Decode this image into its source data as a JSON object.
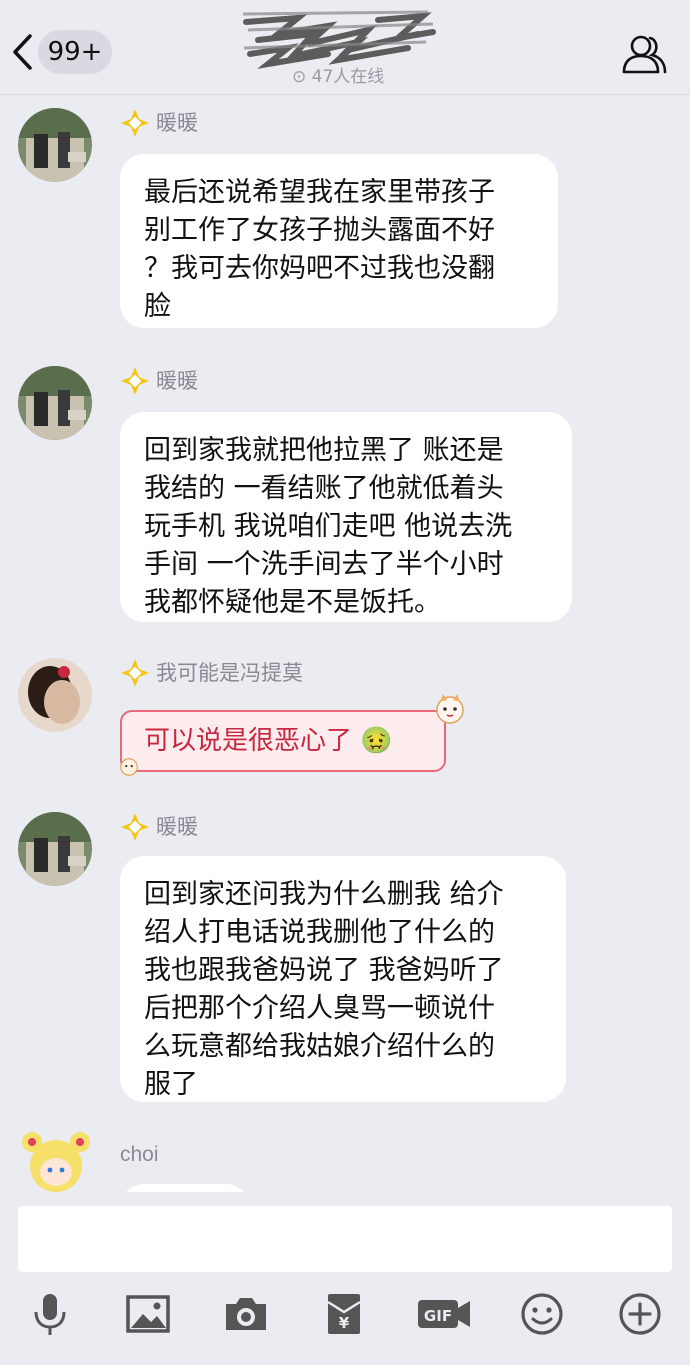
{
  "header": {
    "unread_count": "99+",
    "online_status": "47人在线"
  },
  "messages": [
    {
      "sender": "暖暖",
      "text": "最后还说希望我在家里带孩子\n别工作了女孩子抛头露面不好\n？我可去你妈吧不过我也没翻\n脸"
    },
    {
      "sender": "暖暖",
      "text": "回到家我就把他拉黑了 账还是\n我结的 一看结账了他就低着头\n玩手机 我说咱们走吧 他说去洗\n手间 一个洗手间去了半个小时\n我都怀疑他是不是饭托。"
    },
    {
      "sender": "我可能是冯提莫",
      "text": "可以说是很恶心了",
      "emoji": "🤢"
    },
    {
      "sender": "暖暖",
      "text": "回到家还问我为什么删我 给介\n绍人打电话说我删他了什么的\n我也跟我爸妈说了 我爸妈听了\n后把那个介绍人臭骂一顿说什\n么玩意都给我姑娘介绍什么的\n服了"
    },
    {
      "sender": "choi",
      "text": ""
    }
  ],
  "toolbar": {
    "icons": [
      "microphone-icon",
      "image-icon",
      "camera-icon",
      "red-packet-icon",
      "gif-icon",
      "emoji-icon",
      "plus-icon"
    ]
  },
  "colors": {
    "background": "#ebebf2",
    "bubble": "#ffffff",
    "badge": "#f5c518",
    "special_bubble_border": "#e86a78"
  }
}
